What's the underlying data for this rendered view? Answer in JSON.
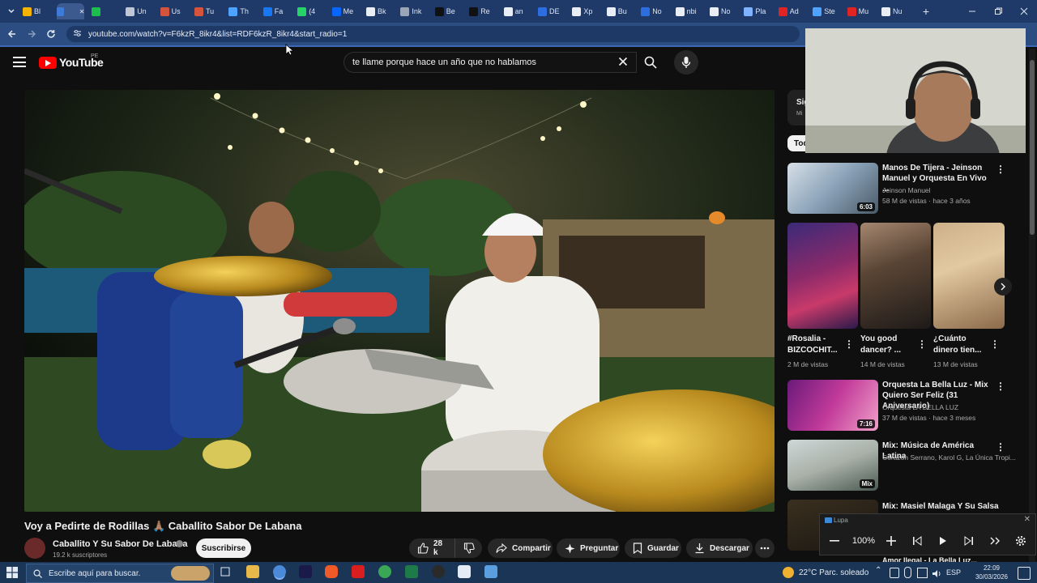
{
  "browser": {
    "tabs": [
      {
        "label": "Bl",
        "color": "#f4b400"
      },
      {
        "label": "",
        "color": "#3e7bd9",
        "active": true
      },
      {
        "label": "",
        "color": "#1bbf4c"
      },
      {
        "label": "Un",
        "color": "#c0c7d4"
      },
      {
        "label": "Us",
        "color": "#d4543d"
      },
      {
        "label": "Tu",
        "color": "#d4543d"
      },
      {
        "label": "Th",
        "color": "#4da3ff"
      },
      {
        "label": "Fa",
        "color": "#1877f2"
      },
      {
        "label": "(4",
        "color": "#25d366"
      },
      {
        "label": "Me",
        "color": "#0866ff"
      },
      {
        "label": "Bk",
        "color": "#e9edf5"
      },
      {
        "label": "Ink",
        "color": "#9aa6b8"
      },
      {
        "label": "Be",
        "color": "#111111"
      },
      {
        "label": "Re",
        "color": "#111111"
      },
      {
        "label": "an",
        "color": "#e9edf5"
      },
      {
        "label": "DE",
        "color": "#2c6ee0"
      },
      {
        "label": "Xp",
        "color": "#e9edf5"
      },
      {
        "label": "Bu",
        "color": "#e9edf5"
      },
      {
        "label": "No",
        "color": "#2c6ee0"
      },
      {
        "label": "nbi",
        "color": "#e9edf5"
      },
      {
        "label": "No",
        "color": "#e9edf5"
      },
      {
        "label": "Pla",
        "color": "#7fb3ff"
      },
      {
        "label": "Ad",
        "color": "#e02424"
      },
      {
        "label": "Ste",
        "color": "#4da3ff"
      },
      {
        "label": "Mu",
        "color": "#e02424"
      },
      {
        "label": "Nu",
        "color": "#e9edf5"
      }
    ],
    "new_tab": "+",
    "url": "youtube.com/watch?v=F6kzR_8ikr4&list=RDF6kzR_8ikr4&start_radio=1"
  },
  "header": {
    "logo_text": "YouTube",
    "country": "PE",
    "search_value": "te llame porque hace un año que no hablamos"
  },
  "video": {
    "title": "Voy a Pedirte de Rodillas 🙏🏽 Caballito Sabor De Labana",
    "channel": "Caballito Y Su Sabor De Labana",
    "subscribers": "19.2 k suscriptores",
    "subscribe": "Suscribirse",
    "likes": "28 k",
    "share": "Compartir",
    "ask": "Preguntar",
    "save": "Guardar",
    "download": "Descargar"
  },
  "sidebar": {
    "chip_partial": "Sig",
    "chip_sub": "Mi",
    "filter_partial": "Tod",
    "items": [
      {
        "title": "Manos De Tijera - Jeinson Manuel y Orquesta En Vivo ...",
        "channel": "Jeinson Manuel",
        "meta": "58 M de vistas · hace 3 años",
        "duration": "6:03"
      },
      {
        "title": "Orquesta La Bella Luz - Mix Quiero Ser Feliz (31 Aniversario)",
        "channel": "Orquesta LA BELLA LUZ",
        "meta": "37 M de vistas · hace 3 meses",
        "duration": "7:16"
      },
      {
        "title": "Mix: Música de América Latina",
        "channel": "Corazón Serrano, Karol G, La Única Tropi...",
        "meta": "",
        "duration": "Mix"
      },
      {
        "title": "Mix: Masiel Malaga Y Su Salsa",
        "channel": "",
        "meta": "",
        "duration": ""
      }
    ],
    "shorts": [
      {
        "title": "#Rosalia - BIZCOCHIT...",
        "views": "2 M de vistas",
        "color": "#6a3a8a"
      },
      {
        "title": "You good dancer? ...",
        "views": "14 M de vistas",
        "color": "#7a5a3a"
      },
      {
        "title": "¿Cuánto dinero tien...",
        "views": "13 M de vistas",
        "color": "#c9a777"
      }
    ],
    "bottom_partial": "Amor Ilegal - La Bella Luz..."
  },
  "lupa": {
    "title": "Lupa",
    "zoom": "100%"
  },
  "taskbar": {
    "search_placeholder": "Escribe aquí para buscar.",
    "weather": "22°C  Parc. soleado",
    "time": "22:09",
    "date": "30/03/2026",
    "lang": "ESP"
  }
}
